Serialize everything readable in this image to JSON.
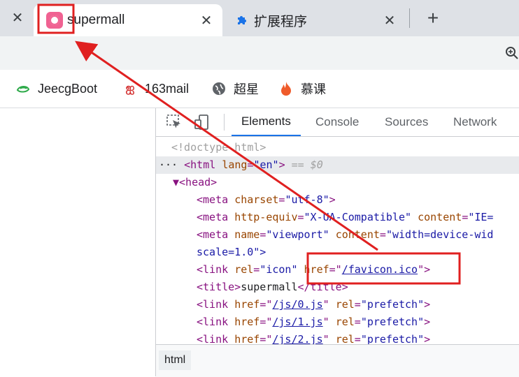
{
  "tabs": [
    {
      "title": "supermall",
      "active": true,
      "favicon": "supermall-flower-icon"
    },
    {
      "title": "扩展程序",
      "active": false,
      "favicon": "puzzle-icon"
    }
  ],
  "toolbar": {
    "zoom_icon": "zoom-in-icon"
  },
  "bookmarks": [
    {
      "label": "JeecgBoot",
      "icon": "jeecg-icon"
    },
    {
      "label": "163mail",
      "icon": "mail163-icon"
    },
    {
      "label": "超星",
      "icon": "globe-icon"
    },
    {
      "label": "慕课",
      "icon": "flame-icon"
    }
  ],
  "devtools": {
    "tabs": [
      "Elements",
      "Console",
      "Sources",
      "Network"
    ],
    "active_tab": "Elements",
    "lines": {
      "doctype": "<!doctype html>",
      "html_tag_open": "<html",
      "html_attr": "lang",
      "html_val": "\"en\"",
      "html_close": ">",
      "html_eq": "== $0",
      "head": "▼<head>",
      "meta1_tag": "<meta",
      "meta1_attr": "charset",
      "meta1_val": "\"utf-8\"",
      "meta1_close": ">",
      "meta2_tag": "<meta",
      "meta2_attr": "http-equiv",
      "meta2_val": "\"X-UA-Compatible\"",
      "meta2_attr2": "content",
      "meta2_val2": "\"IE=",
      "meta3_tag": "<meta",
      "meta3_attr": "name",
      "meta3_val": "\"viewport\"",
      "meta3_attr2": "content",
      "meta3_val2": "\"width=device-wid",
      "meta3_cont": "scale=1.0\">",
      "link1_tag": "<link",
      "link1_attr": "rel",
      "link1_val": "\"icon\"",
      "link1_attr2": "href",
      "link1_href": "/favicon.ico",
      "link1_close": "\">",
      "title_open": "<title>",
      "title_text": "supermall",
      "title_close": "</title>",
      "link2_href": "/js/0.js",
      "link3_href": "/js/1.js",
      "link4_href": "/js/2.js",
      "link_tag": "<link",
      "href_attr": "href",
      "rel_attr": "rel",
      "prefetch_val": "\"prefetch\"",
      "close_angle": ">"
    },
    "breadcrumb": "html"
  },
  "annotation_color": "#e02020"
}
